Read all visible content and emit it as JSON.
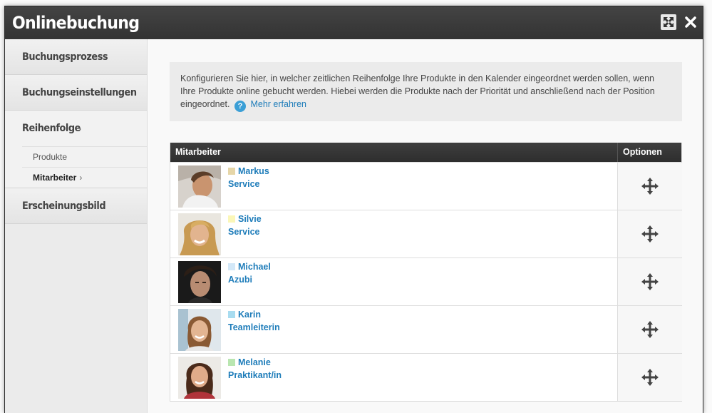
{
  "window": {
    "title": "Onlinebuchung"
  },
  "sidebar": {
    "items": [
      {
        "label": "Buchungsprozess"
      },
      {
        "label": "Buchungseinstellungen"
      },
      {
        "label": "Reihenfolge",
        "chevron": "›"
      },
      {
        "label": "Erscheinungsbild"
      }
    ],
    "subitems": [
      {
        "label": "Produkte"
      },
      {
        "label": "Mitarbeiter",
        "chevron": "›"
      }
    ]
  },
  "info": {
    "text": "Konfigurieren Sie hier, in welcher zeitlichen Reihenfolge Ihre Produkte in den Kalender eingeordnet werden sollen, wenn Ihre Produkte online gebucht werden. Hiebei werden die Produkte nach der Priorität und anschließend nach der Position eingeordnet.",
    "help_icon": "?",
    "link": "Mehr erfahren"
  },
  "table": {
    "columns": [
      "Mitarbeiter",
      "Optionen"
    ],
    "rows": [
      {
        "name": "Markus",
        "role": "Service",
        "color": "#e6d6a8",
        "icon": "move-icon"
      },
      {
        "name": "Silvie",
        "role": "Service",
        "color": "#fbf7b8",
        "icon": "move-icon"
      },
      {
        "name": "Michael",
        "role": "Azubi",
        "color": "#d3e8f8",
        "icon": "move-icon"
      },
      {
        "name": "Karin",
        "role": "Teamleiterin",
        "color": "#a8dcf0",
        "icon": "move-icon"
      },
      {
        "name": "Melanie",
        "role": "Praktikant/in",
        "color": "#b9e6b0",
        "icon": "move-icon"
      }
    ]
  }
}
